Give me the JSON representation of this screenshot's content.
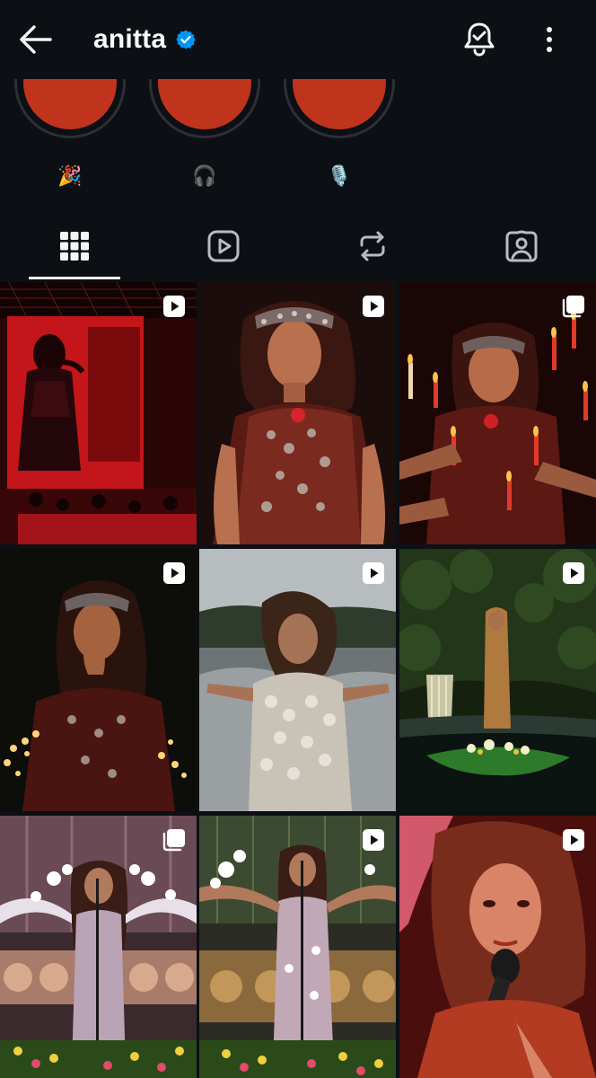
{
  "header": {
    "username": "anitta",
    "back_icon": "arrow-left-icon",
    "verified_icon": "verified-badge-icon",
    "verified_color": "#0095f6",
    "notifications_icon": "bell-check-icon",
    "more_icon": "more-vertical-icon"
  },
  "highlights": [
    {
      "emoji": "🎉",
      "cover_color": "#c0341d"
    },
    {
      "emoji": "🎧",
      "cover_color": "#c0341d"
    },
    {
      "emoji": "🎙️",
      "cover_color": "#c0341d"
    }
  ],
  "tabs": [
    {
      "icon": "grid-icon",
      "active": true
    },
    {
      "icon": "reels-play-icon",
      "active": false
    },
    {
      "icon": "reposts-icon",
      "active": false
    },
    {
      "icon": "tagged-user-icon",
      "active": false
    }
  ],
  "posts": [
    {
      "type": "reel",
      "badge_icon": "reel-play-icon",
      "scene": "red stage concert"
    },
    {
      "type": "reel",
      "badge_icon": "reel-play-icon",
      "scene": "portrait in jeweled headpiece"
    },
    {
      "type": "carousel",
      "badge_icon": "carousel-icon",
      "scene": "candles held around singer"
    },
    {
      "type": "reel",
      "badge_icon": "reel-play-icon",
      "scene": "singer with candlelight"
    },
    {
      "type": "reel",
      "badge_icon": "reel-play-icon",
      "scene": "singer at waterfall in shell dress"
    },
    {
      "type": "reel",
      "badge_icon": "reel-play-icon",
      "scene": "figure standing in jungle pool"
    },
    {
      "type": "carousel",
      "badge_icon": "carousel-icon",
      "scene": "floral stage performance"
    },
    {
      "type": "reel",
      "badge_icon": "reel-play-icon",
      "scene": "floral stage with microphone"
    },
    {
      "type": "reel",
      "badge_icon": "reel-play-icon",
      "scene": "red-lit singer with microphone"
    }
  ],
  "colors": {
    "background": "#0c1014",
    "foreground": "#f5f5f5",
    "highlight_cover": "#c0341d"
  }
}
